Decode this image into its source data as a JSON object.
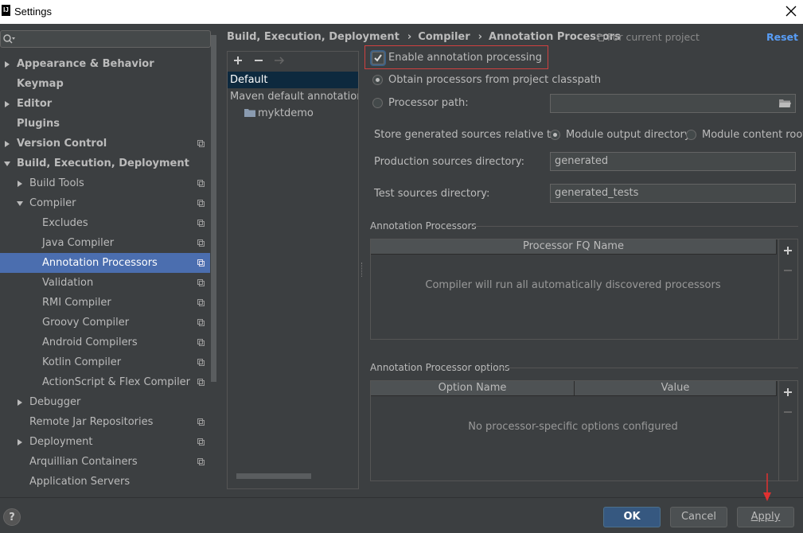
{
  "window": {
    "app_icon": "IJ",
    "title": "Settings"
  },
  "sidebar": {
    "items": [
      {
        "label": "Appearance & Behavior",
        "bold": true
      },
      {
        "label": "Keymap",
        "bold": true
      },
      {
        "label": "Editor",
        "bold": true
      },
      {
        "label": "Plugins",
        "bold": true
      },
      {
        "label": "Version Control",
        "bold": true
      },
      {
        "label": "Build, Execution, Deployment",
        "bold": true
      },
      {
        "label": "Build Tools"
      },
      {
        "label": "Compiler"
      },
      {
        "label": "Excludes"
      },
      {
        "label": "Java Compiler"
      },
      {
        "label": "Annotation Processors",
        "selected": true
      },
      {
        "label": "Validation"
      },
      {
        "label": "RMI Compiler"
      },
      {
        "label": "Groovy Compiler"
      },
      {
        "label": "Android Compilers"
      },
      {
        "label": "Kotlin Compiler"
      },
      {
        "label": "ActionScript & Flex Compiler"
      },
      {
        "label": "Debugger"
      },
      {
        "label": "Remote Jar Repositories"
      },
      {
        "label": "Deployment"
      },
      {
        "label": "Arquillian Containers"
      },
      {
        "label": "Application Servers"
      }
    ]
  },
  "breadcrumb": {
    "items": [
      "Build, Execution, Deployment",
      "Compiler",
      "Annotation Processors"
    ],
    "scope": "For current project",
    "reset_label": "Reset"
  },
  "profiles": {
    "items": [
      "Default",
      "Maven default annotation p",
      "myktdemo"
    ]
  },
  "form": {
    "enable_label": "Enable annotation processing",
    "enable_checked": true,
    "obtain_label": "Obtain processors from project classpath",
    "processor_path_label": "Processor path:",
    "processor_path_value": "",
    "store_label": "Store generated sources relative to:",
    "module_output_label": "Module output directory",
    "module_content_label": "Module content root",
    "prod_label": "Production sources directory:",
    "prod_value": "generated",
    "test_label": "Test sources directory:",
    "test_value": "generated_tests"
  },
  "processors": {
    "section": "Annotation Processors",
    "column": "Processor FQ Name",
    "empty": "Compiler will run all automatically discovered processors"
  },
  "options": {
    "section": "Annotation Processor options",
    "col_name": "Option Name",
    "col_value": "Value",
    "empty": "No processor-specific options configured"
  },
  "buttons": {
    "help": "?",
    "ok": "OK",
    "cancel": "Cancel",
    "apply": "Apply"
  },
  "colors": {
    "accent": "#4b6eaf",
    "link": "#589df6",
    "highlight_box": "#d04040",
    "background": "#3c3f41"
  }
}
